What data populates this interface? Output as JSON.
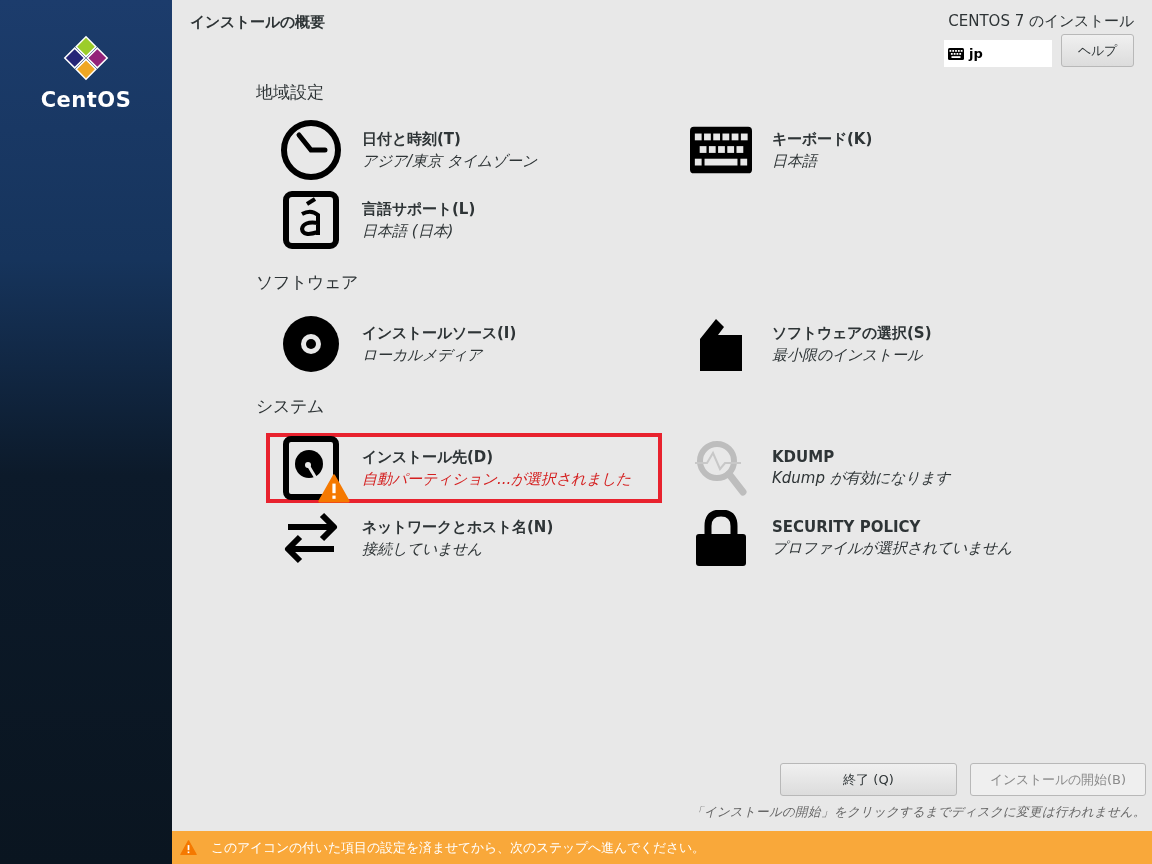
{
  "sidebar": {
    "logo_text": "CentOS"
  },
  "header": {
    "title": "インストールの概要",
    "product": "CENTOS 7 のインストール",
    "keyboard_layout": "jp",
    "help_button": "ヘルプ"
  },
  "sections": [
    {
      "title": "地域設定",
      "spokes": [
        {
          "title": "日付と時刻(T)",
          "status": "アジア/東京 タイムゾーン",
          "warning": false,
          "highlighted": false
        },
        {
          "title": "キーボード(K)",
          "status": "日本語",
          "warning": false,
          "highlighted": false
        },
        {
          "title": "言語サポート(L)",
          "status": "日本語 (日本)",
          "warning": false,
          "highlighted": false
        }
      ]
    },
    {
      "title": "ソフトウェア",
      "spokes": [
        {
          "title": "インストールソース(I)",
          "status": "ローカルメディア",
          "warning": false,
          "highlighted": false
        },
        {
          "title": "ソフトウェアの選択(S)",
          "status": "最小限のインストール",
          "warning": false,
          "highlighted": false
        }
      ]
    },
    {
      "title": "システム",
      "spokes": [
        {
          "title": "インストール先(D)",
          "status": "自動パーティション...が選択されました",
          "warning": true,
          "highlighted": true
        },
        {
          "title": "KDUMP",
          "status": "Kdump が有効になります",
          "warning": false,
          "highlighted": false
        },
        {
          "title": "ネットワークとホスト名(N)",
          "status": "接続していません",
          "warning": false,
          "highlighted": false
        },
        {
          "title": "SECURITY POLICY",
          "status": "プロファイルが選択されていません",
          "warning": false,
          "highlighted": false
        }
      ]
    }
  ],
  "footer": {
    "buttons": [
      {
        "label": "終了 (Q)",
        "disabled": false
      },
      {
        "label": "インストールの開始(B)",
        "disabled": true
      }
    ],
    "note": "「インストールの開始」をクリックするまでディスクに変更は行われません。"
  },
  "warning_bar": {
    "message": "このアイコンの付いた項目の設定を済ませてから、次のステップへ進んでください。"
  }
}
